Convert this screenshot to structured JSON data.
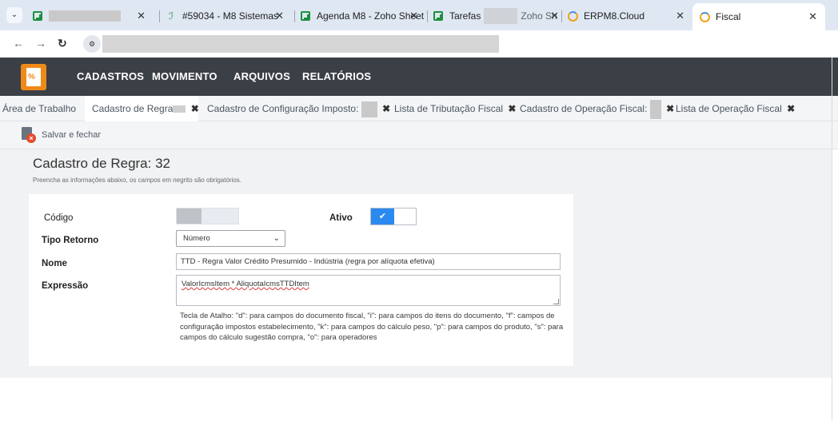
{
  "browser": {
    "tabs": [
      {
        "title": "",
        "icon": "spreadsheet-icon",
        "redacted": true
      },
      {
        "title": "#59034 - M8 Sistemas",
        "icon": "ticket-icon"
      },
      {
        "title": "Agenda M8 - Zoho Sheet",
        "icon": "spreadsheet-icon"
      },
      {
        "title": "Tarefas",
        "title_suffix": "Zoho Sh",
        "icon": "spreadsheet-icon"
      },
      {
        "title": "ERPM8.Cloud",
        "icon": "loading-ring-icon"
      },
      {
        "title": "Fiscal",
        "icon": "loading-ring-icon",
        "active": true
      }
    ],
    "close_glyph": "✕",
    "menu_glyph": "⌄",
    "nav": {
      "back": "←",
      "forward": "→",
      "reload": "↻",
      "site_info": "⚙"
    }
  },
  "app": {
    "logo_text": "%",
    "menu": [
      "CADASTROS",
      "MOVIMENTO",
      "ARQUIVOS",
      "RELATÓRIOS"
    ],
    "tabs": [
      {
        "label": "Área de Trabalho"
      },
      {
        "label": "Cadastro de Regra",
        "redacted": true,
        "closable": true,
        "active": true
      },
      {
        "label": "Cadastro de Configuração Imposto:",
        "redacted": true,
        "closable": true
      },
      {
        "label": "Lista de Tributação Fiscal",
        "closable": true
      },
      {
        "label": "Cadastro de Operação Fiscal:",
        "redacted": true,
        "closable": true
      },
      {
        "label": "Lista de Operação Fiscal",
        "closable": true
      }
    ],
    "tab_close_glyph": "✖",
    "toolbar": {
      "save_close": "Salvar e fechar"
    }
  },
  "form": {
    "title": "Cadastro de Regra: 32",
    "subtitle": "Preencha as informações abaixo, os campos em negrito são obrigatórios.",
    "code_label": "Código",
    "active_label": "Ativo",
    "active": true,
    "check_glyph": "✔",
    "return_type_label": "Tipo Retorno",
    "return_type_value": "Número",
    "name_label": "Nome",
    "name_value": "TTD - Regra Valor  Crédito Presumido - Indústria (regra por alíquota efetiva)",
    "expression_label": "Expressão",
    "expression_value": "ValorIcmsItem * AliquotaIcmsTTDItem",
    "hint": "Tecla de Atalho: \"d\": para campos do documento fiscal, \"i\": para campos do itens do documento, \"f\": campos de configuração impostos estabelecimento, \"k\": para campos do cálculo peso, \"p\": para campos do produto, \"s\": para campos do cálculo sugestão compra, \"o\": para operadores"
  },
  "colors": {
    "header_bg": "#3b3f46",
    "accent_blue": "#2a8af0",
    "logo_orange": "#ef8a19",
    "close_red": "#e34b2e"
  }
}
